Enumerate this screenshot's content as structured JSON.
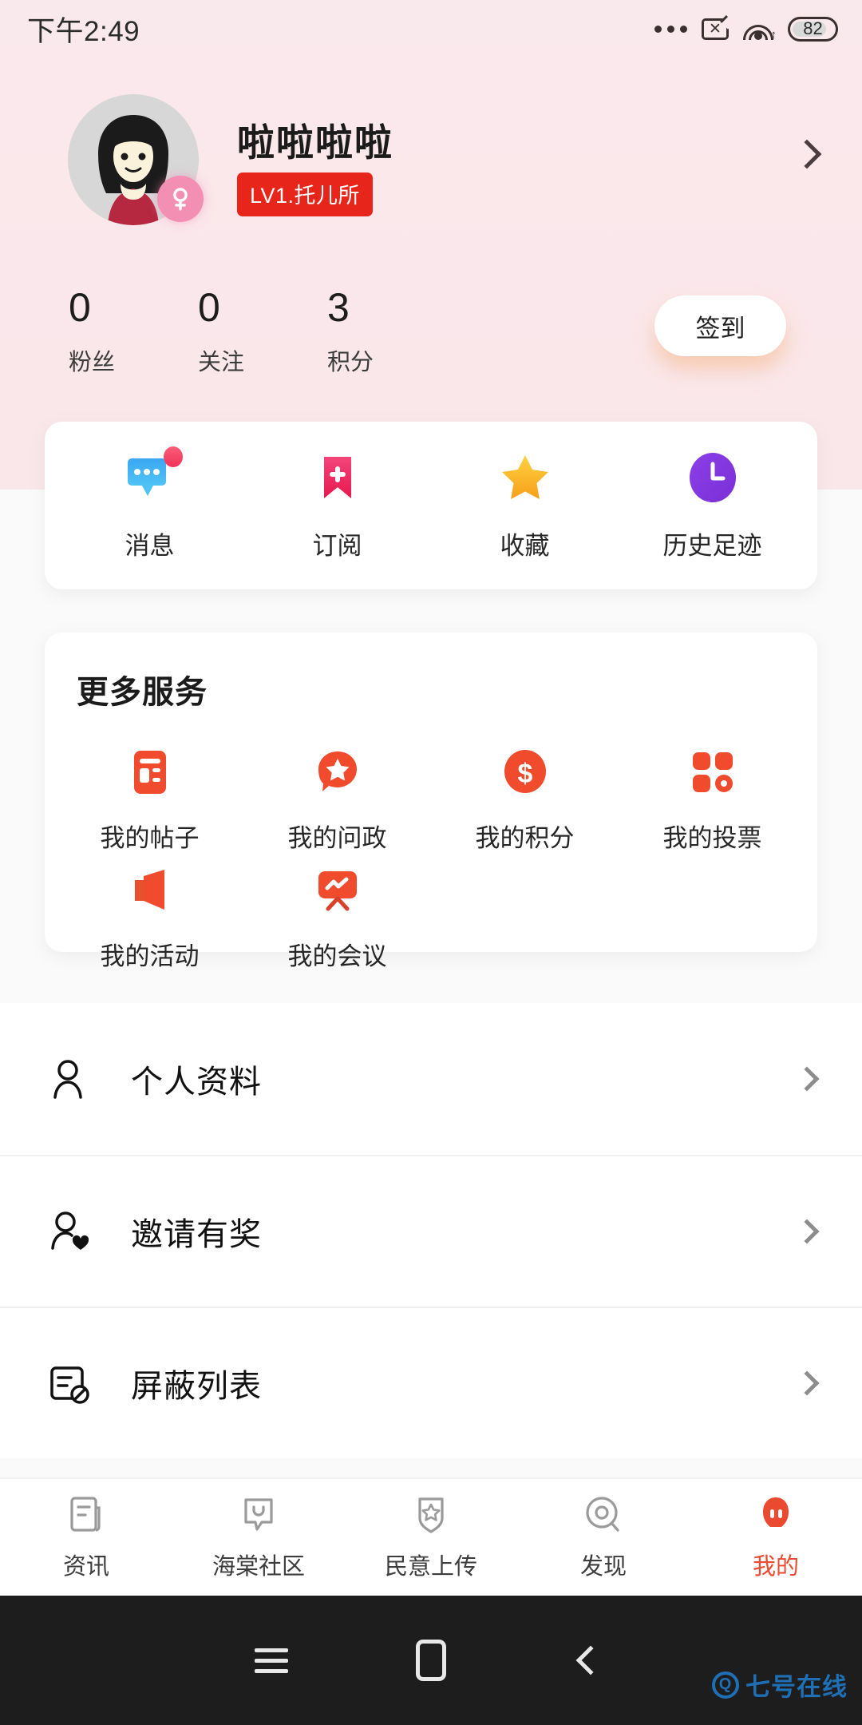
{
  "status_bar": {
    "time": "下午2:49",
    "battery_level": "82",
    "icons": [
      "more-dots-icon",
      "sim-card-off-icon",
      "wifi-icon",
      "battery-icon"
    ]
  },
  "profile": {
    "username": "啦啦啦啦",
    "level_badge": "LV1.托儿所",
    "gender": "female",
    "avatar_alt": "user-avatar",
    "chevron": "chevron-right-icon",
    "header_bg_color": "#fae8ec",
    "level_badge_color": "#e8251a"
  },
  "stats": [
    {
      "value": "0",
      "label": "粉丝"
    },
    {
      "value": "0",
      "label": "关注"
    },
    {
      "value": "3",
      "label": "积分"
    }
  ],
  "signin": {
    "label": "签到"
  },
  "quick_actions": [
    {
      "label": "消息",
      "icon": "message-bubble-icon",
      "color": "#35a9f0",
      "badge": true
    },
    {
      "label": "订阅",
      "icon": "bookmark-plus-icon",
      "color": "#ef2e5b",
      "badge": false
    },
    {
      "label": "收藏",
      "icon": "star-icon",
      "color": "#fdb827",
      "badge": false
    },
    {
      "label": "历史足迹",
      "icon": "clock-history-icon",
      "color": "#8a3ee0",
      "badge": false
    }
  ],
  "more_services": {
    "title": "更多服务",
    "accent_color": "#ef4b2c",
    "items": [
      {
        "label": "我的帖子",
        "icon": "article-layout-icon"
      },
      {
        "label": "我的问政",
        "icon": "star-bubble-icon"
      },
      {
        "label": "我的积分",
        "icon": "dollar-coin-icon"
      },
      {
        "label": "我的投票",
        "icon": "four-squares-vote-icon"
      },
      {
        "label": "我的活动",
        "icon": "megaphone-flag-icon"
      },
      {
        "label": "我的会议",
        "icon": "presentation-board-icon"
      }
    ]
  },
  "settings_list": [
    {
      "label": "个人资料",
      "icon": "person-icon"
    },
    {
      "label": "邀请有奖",
      "icon": "person-heart-icon"
    },
    {
      "label": "屏蔽列表",
      "icon": "block-list-icon"
    }
  ],
  "tabbar": {
    "active_color": "#ea4a2f",
    "items": [
      {
        "label": "资讯",
        "icon": "news-document-icon",
        "active": false
      },
      {
        "label": "海棠社区",
        "icon": "community-bubble-icon",
        "active": false
      },
      {
        "label": "民意上传",
        "icon": "shield-star-icon",
        "active": false
      },
      {
        "label": "发现",
        "icon": "discover-circle-icon",
        "active": false
      },
      {
        "label": "我的",
        "icon": "profile-person-icon",
        "active": true
      }
    ]
  },
  "android_nav": {
    "buttons": [
      "menu-icon",
      "home-icon",
      "back-icon"
    ]
  },
  "watermark": {
    "text": "七号在线",
    "mark": "Q"
  }
}
